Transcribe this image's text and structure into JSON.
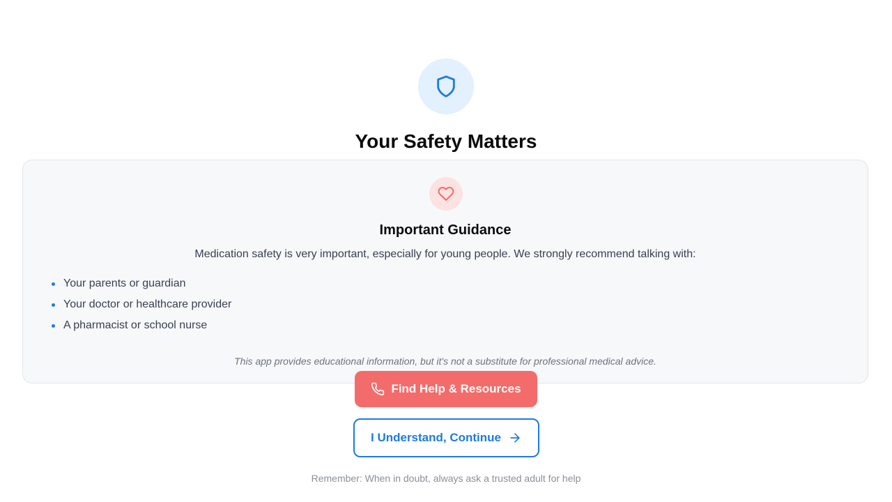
{
  "header": {
    "icon": "shield-icon",
    "title": "Your Safety Matters"
  },
  "card": {
    "icon": "heart-icon",
    "title": "Important Guidance",
    "intro": "Medication safety is very important, especially for young people. We strongly recommend talking with:",
    "items": [
      "Your parents or guardian",
      "Your doctor or healthcare provider",
      "A pharmacist or school nurse"
    ],
    "disclaimer": "This app provides educational information, but it's not a substitute for professional medical advice."
  },
  "actions": {
    "help_label": "Find Help & Resources",
    "help_icon": "phone-icon",
    "continue_label": "I Understand, Continue",
    "continue_icon": "arrow-right-icon"
  },
  "footer": {
    "reminder": "Remember: When in doubt, always ask a trusted adult for help"
  },
  "colors": {
    "primary": "#1f7ae0",
    "accent": "#f46b6b",
    "shield_bg": "#e3f0fd",
    "heart_bg": "#fde2e2",
    "card_bg": "#f7f8fa"
  }
}
